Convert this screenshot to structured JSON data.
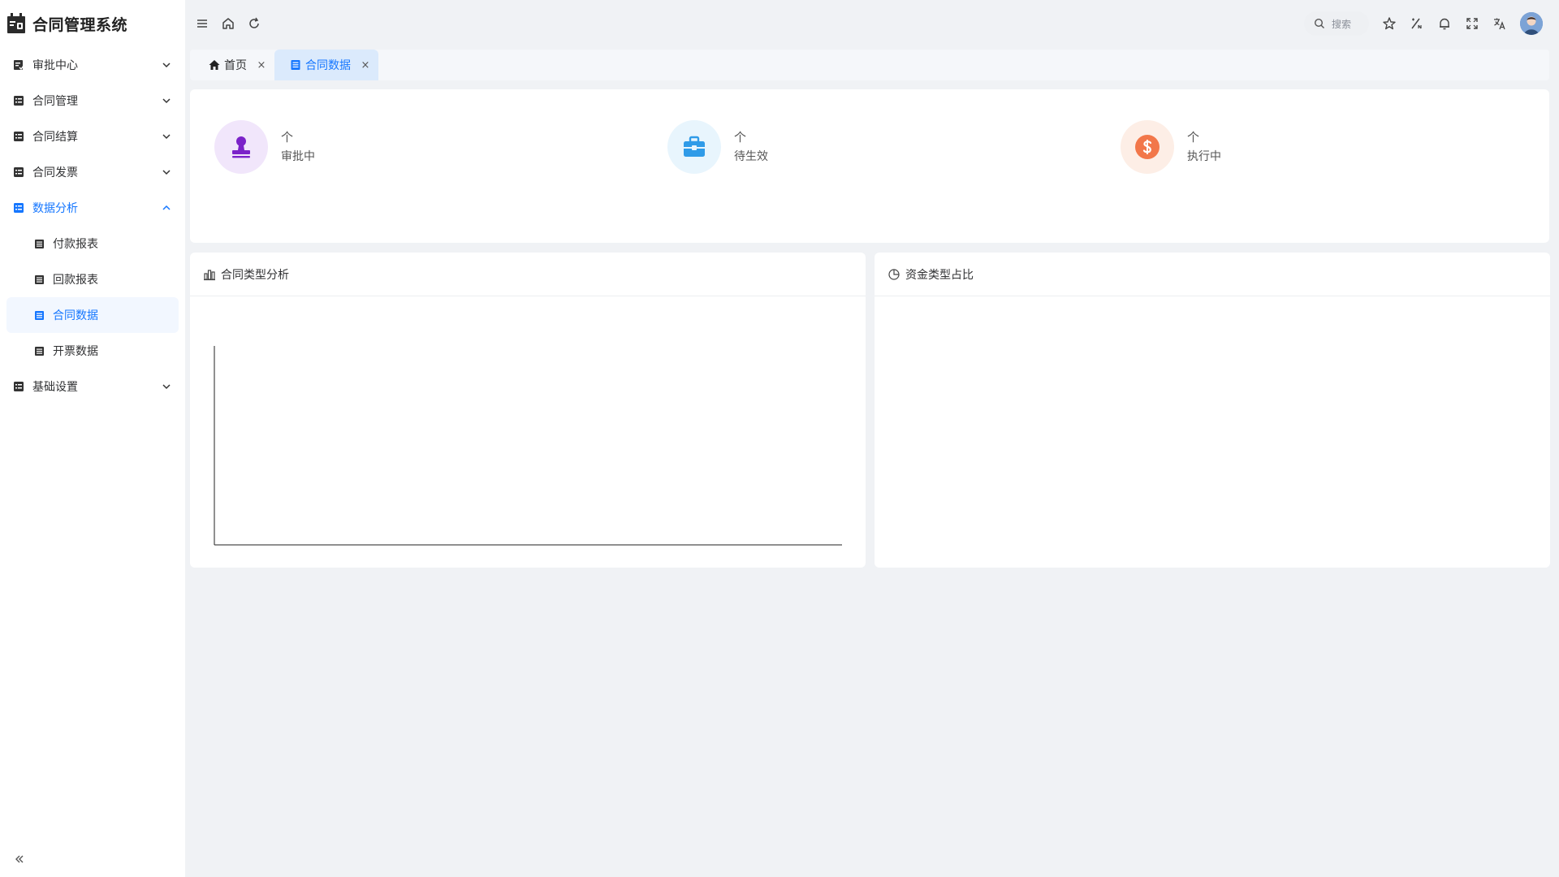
{
  "brand": {
    "title": "合同管理系统"
  },
  "sidebar": {
    "items": [
      {
        "label": "审批中心"
      },
      {
        "label": "合同管理"
      },
      {
        "label": "合同结算"
      },
      {
        "label": "合同发票"
      },
      {
        "label": "数据分析",
        "children": [
          {
            "label": "付款报表"
          },
          {
            "label": "回款报表"
          },
          {
            "label": "合同数据"
          },
          {
            "label": "开票数据"
          }
        ]
      },
      {
        "label": "基础设置"
      }
    ]
  },
  "header": {
    "search_placeholder": "搜索",
    "icons": [
      "menu-icon",
      "home-icon",
      "refresh-icon",
      "search-icon",
      "star-icon",
      "clear-cache-icon",
      "bell-icon",
      "fullscreen-icon",
      "translate-icon"
    ]
  },
  "tabs": [
    {
      "label": "首页",
      "close": "×"
    },
    {
      "label": "合同数据",
      "close": "×"
    }
  ],
  "stats": [
    {
      "value": "个",
      "label": "审批中",
      "icon": "stamp-icon",
      "color": "#7b22c9",
      "bg": "#f1e6fb"
    },
    {
      "value": "个",
      "label": "待生效",
      "icon": "briefcase-icon",
      "color": "#2f9be8",
      "bg": "#e8f5fd"
    },
    {
      "value": "个",
      "label": "执行中",
      "icon": "dollar-icon",
      "color": "#f2774a",
      "bg": "#fdeee6"
    }
  ],
  "panels": {
    "left_title": "合同类型分析",
    "right_title": "资金类型占比"
  },
  "colors": {
    "accent": "#1677ff",
    "active_bg": "#f2f7ff"
  },
  "chart_data": [
    {
      "type": "bar",
      "title": "",
      "categories": [],
      "series": []
    },
    {
      "type": "pie",
      "title": "",
      "categories": [],
      "values": []
    }
  ]
}
